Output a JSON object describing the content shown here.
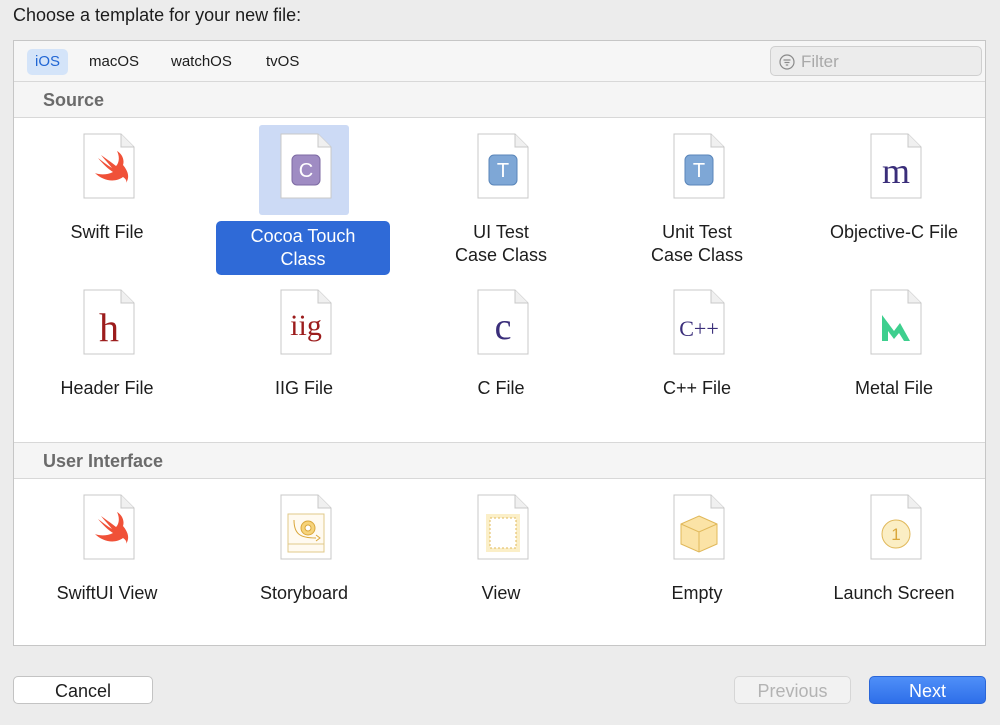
{
  "heading": "Choose a template for your new file:",
  "tabs": [
    {
      "label": "iOS",
      "active": true
    },
    {
      "label": "macOS",
      "active": false
    },
    {
      "label": "watchOS",
      "active": false
    },
    {
      "label": "tvOS",
      "active": false
    }
  ],
  "filter": {
    "placeholder": "Filter",
    "icon": "filter-icon"
  },
  "sections": [
    {
      "title": "Source",
      "items": [
        {
          "label": "Swift File",
          "icon": "swift-icon"
        },
        {
          "label": "Cocoa Touch\nClass",
          "icon": "class-icon",
          "glyph": "C",
          "selected": true
        },
        {
          "label": "UI Test\nCase Class",
          "icon": "test-case-icon",
          "glyph": "T"
        },
        {
          "label": "Unit Test\nCase Class",
          "icon": "test-case-icon",
          "glyph": "T"
        },
        {
          "label": "Objective-C File",
          "icon": "objc-m-icon",
          "glyph": "m"
        },
        {
          "label": "Header File",
          "icon": "header-h-icon",
          "glyph": "h"
        },
        {
          "label": "IIG File",
          "icon": "iig-icon",
          "glyph": "iig"
        },
        {
          "label": "C File",
          "icon": "c-file-icon",
          "glyph": "c"
        },
        {
          "label": "C++ File",
          "icon": "cpp-file-icon",
          "glyph": "C++"
        },
        {
          "label": "Metal File",
          "icon": "metal-icon"
        }
      ]
    },
    {
      "title": "User Interface",
      "items": [
        {
          "label": "SwiftUI View",
          "icon": "swift-icon"
        },
        {
          "label": "Storyboard",
          "icon": "storyboard-icon"
        },
        {
          "label": "View",
          "icon": "view-icon"
        },
        {
          "label": "Empty",
          "icon": "empty-cube-icon"
        },
        {
          "label": "Launch Screen",
          "icon": "launch-screen-icon",
          "glyph": "1"
        }
      ]
    }
  ],
  "buttons": {
    "cancel": "Cancel",
    "previous": "Previous",
    "next": "Next"
  },
  "colors": {
    "accent": "#2f6ad7",
    "selected_icon_bg": "#ccdaf5",
    "next_button": "#3478f6"
  }
}
